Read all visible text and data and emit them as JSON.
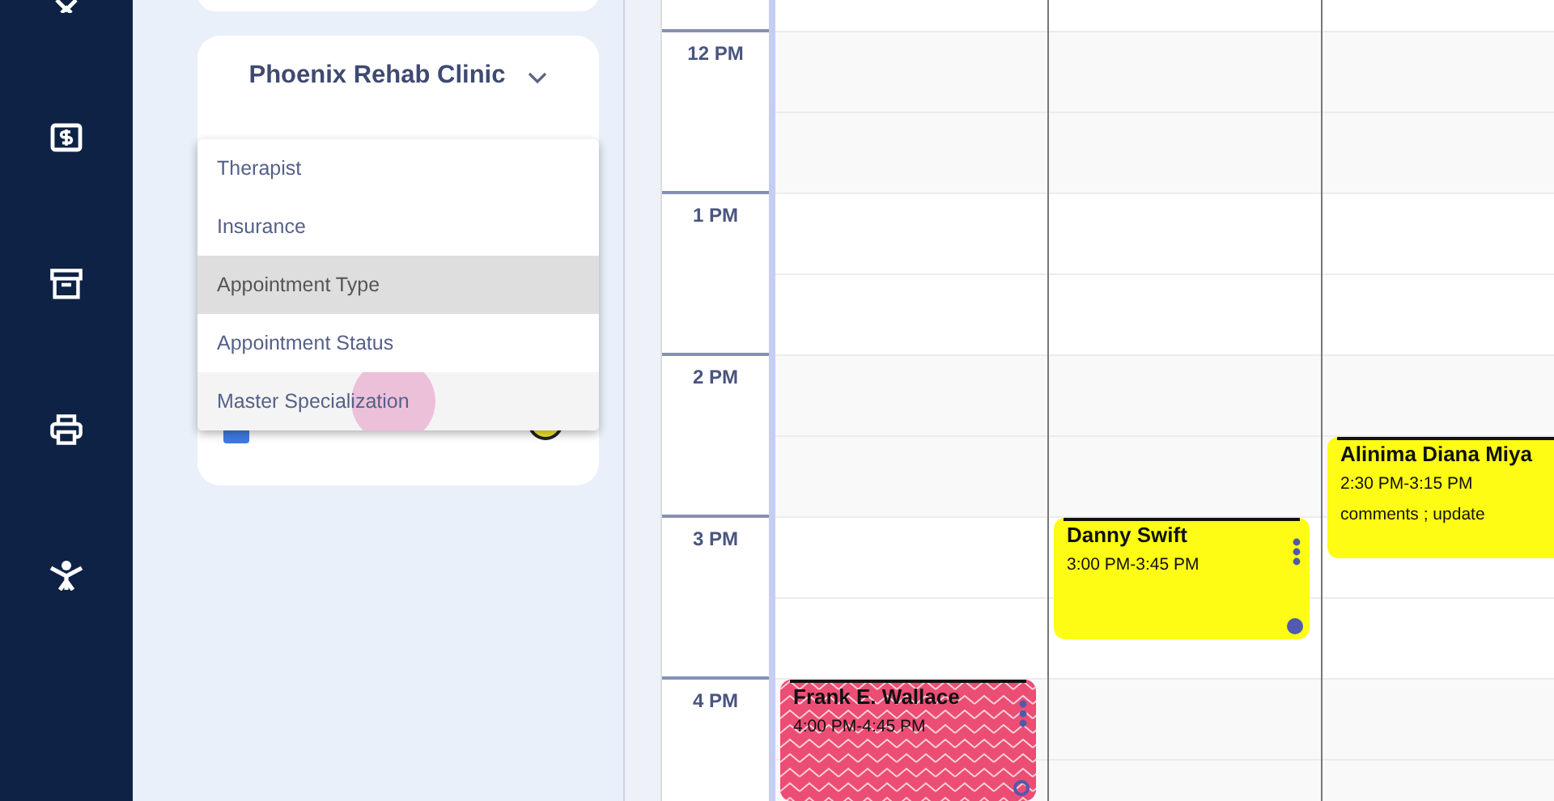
{
  "nav": {
    "items": [
      {
        "kind": "cross"
      },
      {
        "kind": "bill"
      },
      {
        "kind": "archive"
      },
      {
        "kind": "printer"
      },
      {
        "kind": "figure"
      }
    ]
  },
  "clinic_selector": {
    "label": "Phoenix Rehab Clinic"
  },
  "filter_row": {
    "checked": true
  },
  "filter_menu": {
    "items": [
      {
        "label": "Therapist",
        "selected": false,
        "hovered": false
      },
      {
        "label": "Insurance",
        "selected": false,
        "hovered": false
      },
      {
        "label": "Appointment Type",
        "selected": true,
        "hovered": false
      },
      {
        "label": "Appointment Status",
        "selected": false,
        "hovered": false
      },
      {
        "label": "Master Specialization",
        "selected": false,
        "hovered": true
      }
    ]
  },
  "calendar": {
    "hours": [
      {
        "label": "12 PM"
      },
      {
        "label": "1 PM"
      },
      {
        "label": "2 PM"
      },
      {
        "label": "3 PM"
      },
      {
        "label": "4 PM"
      }
    ],
    "columns": [
      {
        "events": [
          {
            "name": "Frank E. Wallace",
            "time": "4:00 PM-4:45 PM",
            "kind": "zigzag",
            "color": "#ec4d74",
            "status_filled": false
          }
        ]
      },
      {
        "events": [
          {
            "name": "Danny Swift",
            "time": "3:00 PM-3:45 PM",
            "kind": "solid",
            "color": "#fefb14",
            "status_filled": true
          }
        ]
      },
      {
        "events": [
          {
            "name": "Alinima Diana Miya",
            "time": "2:30 PM-3:15 PM",
            "comment": "comments ; update",
            "kind": "solid",
            "color": "#fefb14"
          }
        ]
      }
    ]
  }
}
